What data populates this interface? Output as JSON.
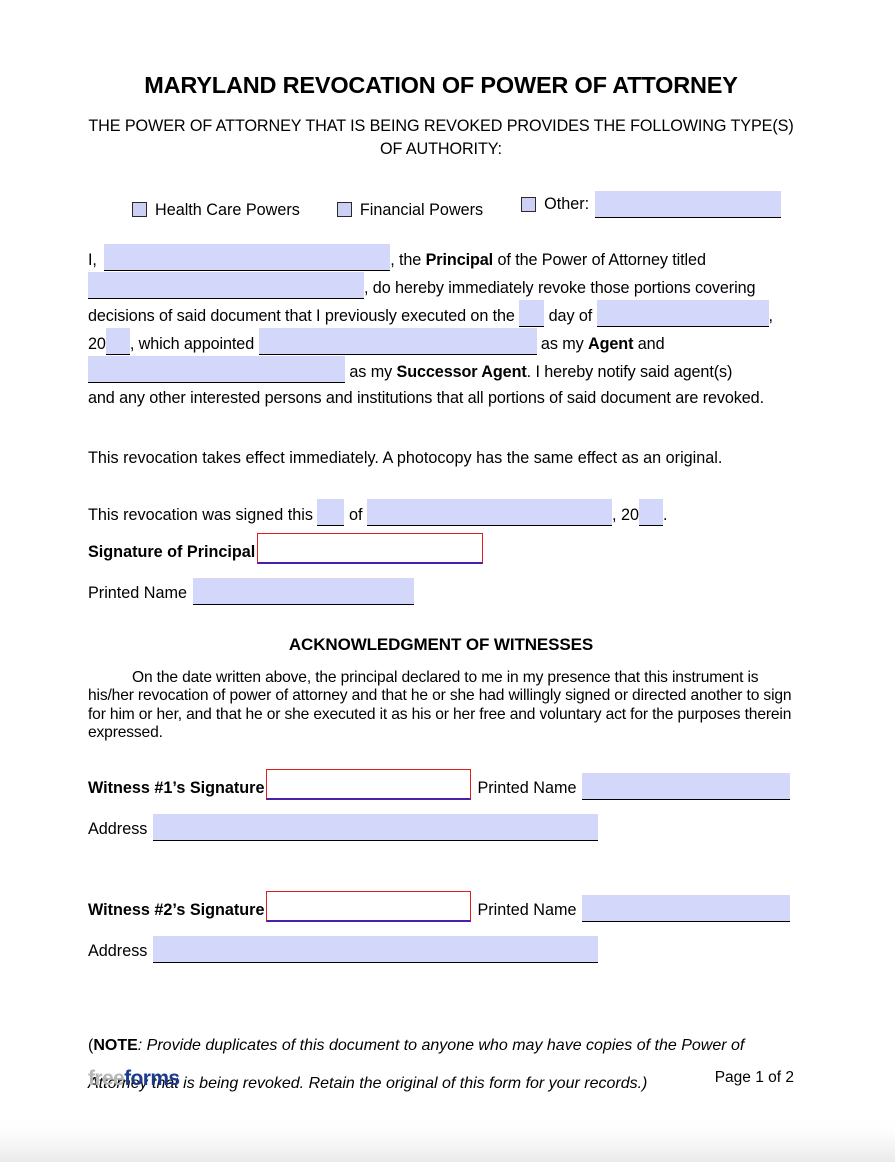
{
  "document": {
    "title": "MARYLAND REVOCATION OF POWER OF ATTORNEY",
    "subtitle": "THE POWER OF ATTORNEY THAT IS BEING REVOKED PROVIDES THE FOLLOWING TYPE(S) OF AUTHORITY:"
  },
  "authority_types": {
    "options": [
      {
        "label": "Health Care Powers",
        "checked": false
      },
      {
        "label": "Financial Powers",
        "checked": false
      },
      {
        "label": "Other:",
        "checked": false,
        "value": ""
      }
    ]
  },
  "body": {
    "line1_pre": "I,",
    "line1_post": ", the",
    "principal_bold": "Principal",
    "line1_tail": "of the Power of Attorney titled",
    "line2_post": ", do hereby immediately revoke those portions covering",
    "line3_pre": "decisions of said document that I previously executed on the",
    "line3_mid": "day of",
    "line3_post": ",",
    "line4_pre": "20",
    "line4_mid": ", which appointed",
    "line4_post": "as my",
    "agent_bold": "Agent",
    "line4_tail": "and",
    "line5_post": "as my",
    "successor_bold": "Successor Agent",
    "line5_tail": ". I hereby notify said agent(s)",
    "line6": "and any other interested persons and institutions that all portions of said document are revoked.",
    "values": {
      "principal_name": "",
      "poa_title": "",
      "day": "",
      "month": "",
      "year": "",
      "agent_name": "",
      "successor_agent_name": ""
    }
  },
  "effect_statement": "This revocation takes effect immediately. A photocopy has the same effect as an original.",
  "execution": {
    "prefix": "This revocation was signed this",
    "mid": "of",
    "comma": ",",
    "year_prefix": "20",
    "period": ".",
    "values": {
      "day": "",
      "month": "",
      "year": ""
    }
  },
  "principal_signature": {
    "signature_label": "Signature of Principal",
    "signature_value": "",
    "printed_name_label": "Printed Name",
    "printed_name_value": ""
  },
  "witness_section": {
    "heading": "ACKNOWLEDGMENT OF WITNESSES",
    "paragraph": "On the date written above, the principal declared to me in my presence that this instrument is his/her revocation of power of attorney and that he or she had willingly signed or directed another to sign for him or her, and that he or she executed it as his or her free and voluntary act for the purposes therein expressed.",
    "witnesses": [
      {
        "signature_label": "Witness #1’s Signature",
        "signature_value": "",
        "printed_name_label": "Printed Name",
        "printed_name_value": "",
        "address_label": "Address",
        "address_value": ""
      },
      {
        "signature_label": "Witness #2’s Signature",
        "signature_value": "",
        "printed_name_label": "Printed Name",
        "printed_name_value": "",
        "address_label": "Address",
        "address_value": ""
      }
    ]
  },
  "note": {
    "open_paren": "(",
    "bold": "NOTE",
    "text": ": Provide duplicates of this document to anyone who may have copies of the Power of Attorney that is being revoked. Retain the original of this form for your records.)"
  },
  "footer": {
    "logo_part1": "free",
    "logo_part2": "forms",
    "page_number": "Page 1 of 2"
  },
  "colors": {
    "field_fill": "#d3d8fb",
    "signature_border": "#e21b1b",
    "signature_underline": "#4b1fa8",
    "logo_gray": "#b6b6b6",
    "logo_blue": "#1a3a8f"
  }
}
